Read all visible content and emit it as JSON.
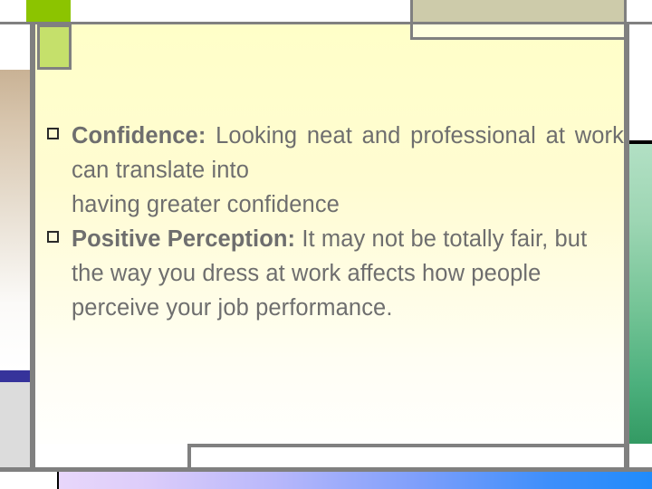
{
  "slide": {
    "content": {
      "bullets": [
        {
          "lead": "Confidence:",
          "text": " Looking neat and professional at work can translate into",
          "tail": "having greater confidence",
          "justified": true
        },
        {
          "lead": "Positive Perception:",
          "text": " It may not be totally fair, but the way you dress at work affects how people perceive your job performance.",
          "tail": "",
          "justified": false
        }
      ]
    },
    "decor": {
      "lime_top": "lime-accent-block",
      "lime_body": "lime-panel-block",
      "tan_top": "tan-accent-block",
      "left_gradient": "tan-to-white-gradient-strip",
      "left_blue": "blue-accent-bar",
      "left_gray": "gray-footer-strip",
      "right_green": "green-gradient-strip",
      "bottom_gradient": "purple-to-blue-gradient-bar"
    },
    "colors": {
      "lime": "#8cc400",
      "lime_light": "#c5e06b",
      "tan": "#cdcbaa",
      "rule": "#808080",
      "text": "#6e6e6e",
      "blue_bar": "#36339b",
      "green_end": "#339a63",
      "panel_top": "#ffffc8"
    }
  }
}
